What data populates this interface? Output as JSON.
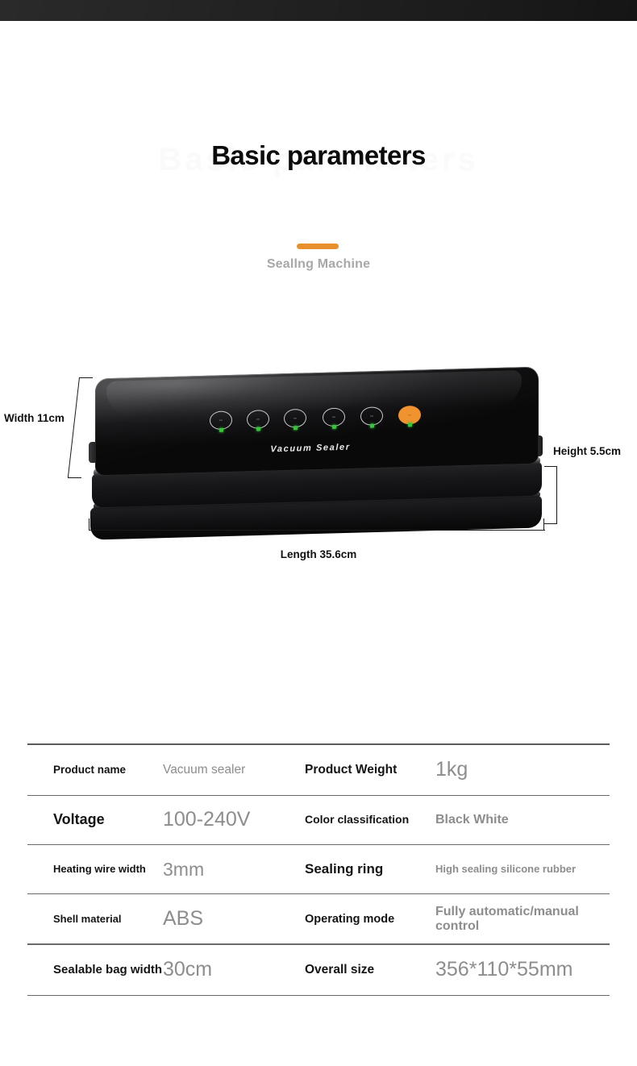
{
  "header": {
    "title": "Basic parameters",
    "subtitle": "Seallng Machine",
    "accent_color": "#e8902b"
  },
  "product": {
    "brand_text": "Vacuum Sealer",
    "body_color": "#0a0a0b",
    "active_button_color": "#f0922e",
    "led_color": "#35c43a",
    "buttons": [
      {
        "name": "mode-button-1",
        "glyph": "▫▫",
        "active": false
      },
      {
        "name": "mode-button-2",
        "glyph": "▫▫",
        "active": false
      },
      {
        "name": "mode-button-3",
        "glyph": "▫▫",
        "active": false
      },
      {
        "name": "mode-button-4",
        "glyph": "▫▫",
        "active": false
      },
      {
        "name": "mode-button-5",
        "glyph": "▫▫",
        "active": false
      },
      {
        "name": "stop-button",
        "glyph": "▫▫",
        "active": true
      }
    ],
    "dimensions": {
      "width": "Width 11cm",
      "height": "Height 5.5cm",
      "length": "Length 35.6cm"
    }
  },
  "spec_table": {
    "rows": [
      {
        "label1": "Product name",
        "value1": "Vacuum sealer",
        "label2": "Product Weight",
        "value2": "1kg"
      },
      {
        "label1": "Voltage",
        "value1": "100-240V",
        "label2": "Color classification",
        "value2": "Black White"
      },
      {
        "label1": "Heating wire width",
        "value1": "3mm",
        "label2": "Sealing ring",
        "value2": "High sealing silicone rubber"
      },
      {
        "label1": "Shell material",
        "value1": "ABS",
        "label2": "Operating mode",
        "value2": "Fully automatic/manual control"
      },
      {
        "label1": "Sealable bag width",
        "value1": "30cm",
        "label2": "Overall size",
        "value2": "356*110*55mm"
      }
    ]
  }
}
